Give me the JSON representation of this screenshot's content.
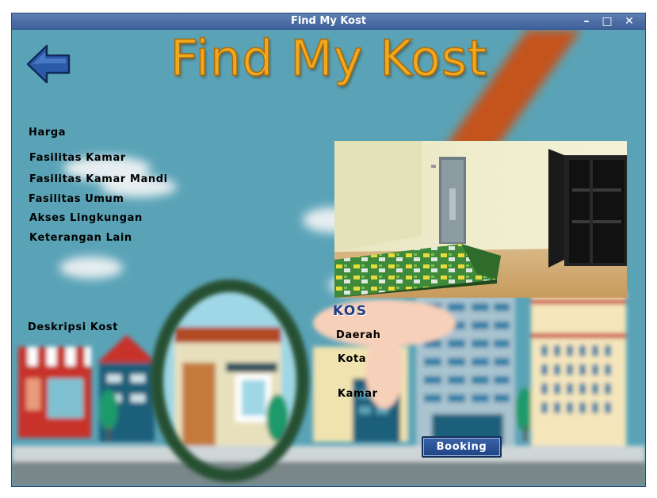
{
  "window": {
    "title": "Find My Kost"
  },
  "header": {
    "app_title": "Find My Kost"
  },
  "details": {
    "harga": "Harga",
    "fasilitas_kamar": "Fasilitas Kamar",
    "fasilitas_kamar_mandi": "Fasilitas Kamar Mandi",
    "fasilitas_umum": "Fasilitas Umum",
    "akses_lingkungan": "Akses Lingkungan",
    "keterangan_lain": "Keterangan Lain",
    "deskripsi_kost": "Deskripsi Kost"
  },
  "info": {
    "heading": "KOS",
    "daerah": "Daerah",
    "kota": "Kota",
    "kamar": "Kamar"
  },
  "actions": {
    "booking_label": "Booking"
  },
  "icons": {
    "back": "arrow-left-icon",
    "minimize": "minimize-icon",
    "maximize": "maximize-icon",
    "close": "close-icon"
  },
  "colors": {
    "title_bar": "#3c5e97",
    "background": "#5aa3b7",
    "title_text": "#f2a81d",
    "booking_button": "#2a4f92",
    "kos_heading": "#1d3f87"
  }
}
